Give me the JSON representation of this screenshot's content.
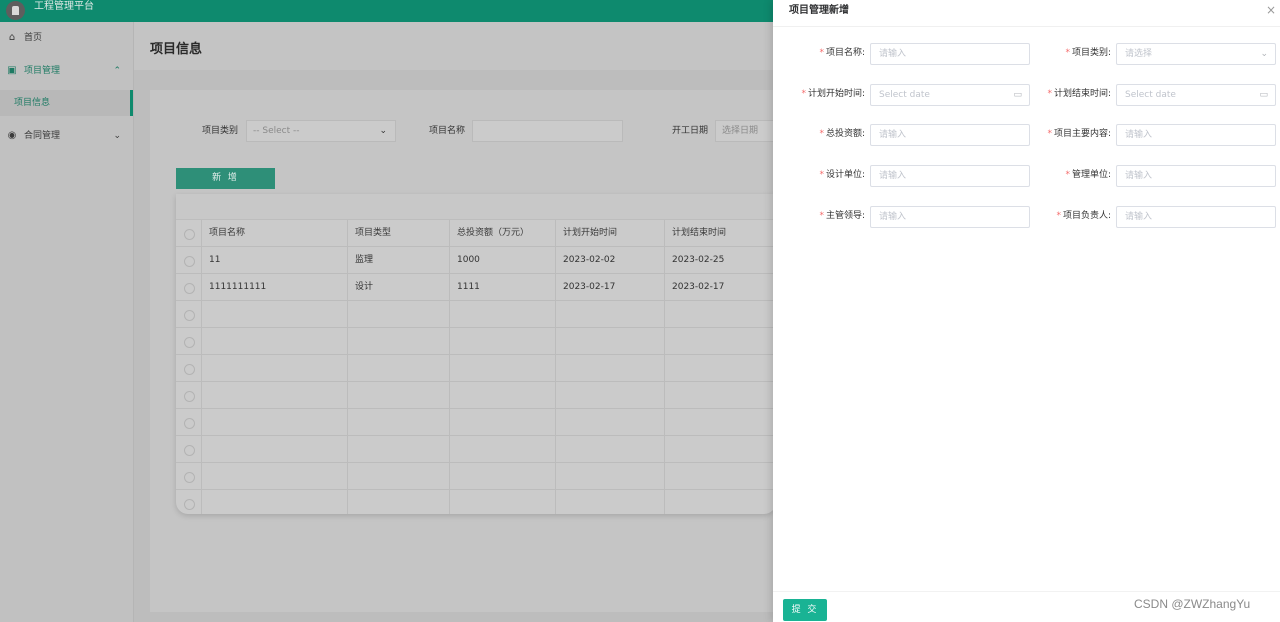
{
  "app": {
    "title": "工程管理平台"
  },
  "sidebar": {
    "items": [
      {
        "label": "首页",
        "icon": "home-icon"
      },
      {
        "label": "项目管理",
        "icon": "document-icon",
        "expanded": true
      },
      {
        "label": "合同管理",
        "icon": "contract-icon",
        "expanded": false
      }
    ],
    "sub_item": "项目信息"
  },
  "page": {
    "title": "项目信息"
  },
  "filters": {
    "category_label": "项目类别",
    "category_value": "-- Select --",
    "name_label": "项目名称",
    "name_value": "",
    "date_label": "开工日期",
    "date_placeholder": "选择日期"
  },
  "add_button": "新 增",
  "table": {
    "headers": [
      "项目名称",
      "项目类型",
      "总投资额（万元）",
      "计划开始时间",
      "计划结束时间"
    ],
    "rows": [
      [
        "11",
        "监理",
        "1000",
        "2023-02-02",
        "2023-02-25"
      ],
      [
        "1111111111",
        "设计",
        "1111",
        "2023-02-17",
        "2023-02-17"
      ]
    ],
    "empty_rows": 8
  },
  "drawer": {
    "title": "项目管理新增",
    "close": "×",
    "fields": {
      "name": {
        "label": "项目名称:",
        "placeholder": "请输入"
      },
      "category": {
        "label": "项目类别:",
        "placeholder": "请选择"
      },
      "plan_start": {
        "label": "计划开始时间:",
        "placeholder": "Select date"
      },
      "plan_end": {
        "label": "计划结束时间:",
        "placeholder": "Select date"
      },
      "investment": {
        "label": "总投资额:",
        "placeholder": "请输入"
      },
      "main_content": {
        "label": "项目主要内容:",
        "placeholder": "请输入"
      },
      "design_unit": {
        "label": "设计单位:",
        "placeholder": "请输入"
      },
      "manage_unit": {
        "label": "管理单位:",
        "placeholder": "请输入"
      },
      "leader": {
        "label": "主管领导:",
        "placeholder": "请输入"
      },
      "owner": {
        "label": "项目负责人:",
        "placeholder": "请输入"
      }
    },
    "required_mark": "*",
    "submit": "提 交"
  },
  "watermark": "CSDN @ZWZhangYu",
  "colors": {
    "brand": "#0e8a6e",
    "submit": "#19b394",
    "required": "#f56c6c"
  }
}
